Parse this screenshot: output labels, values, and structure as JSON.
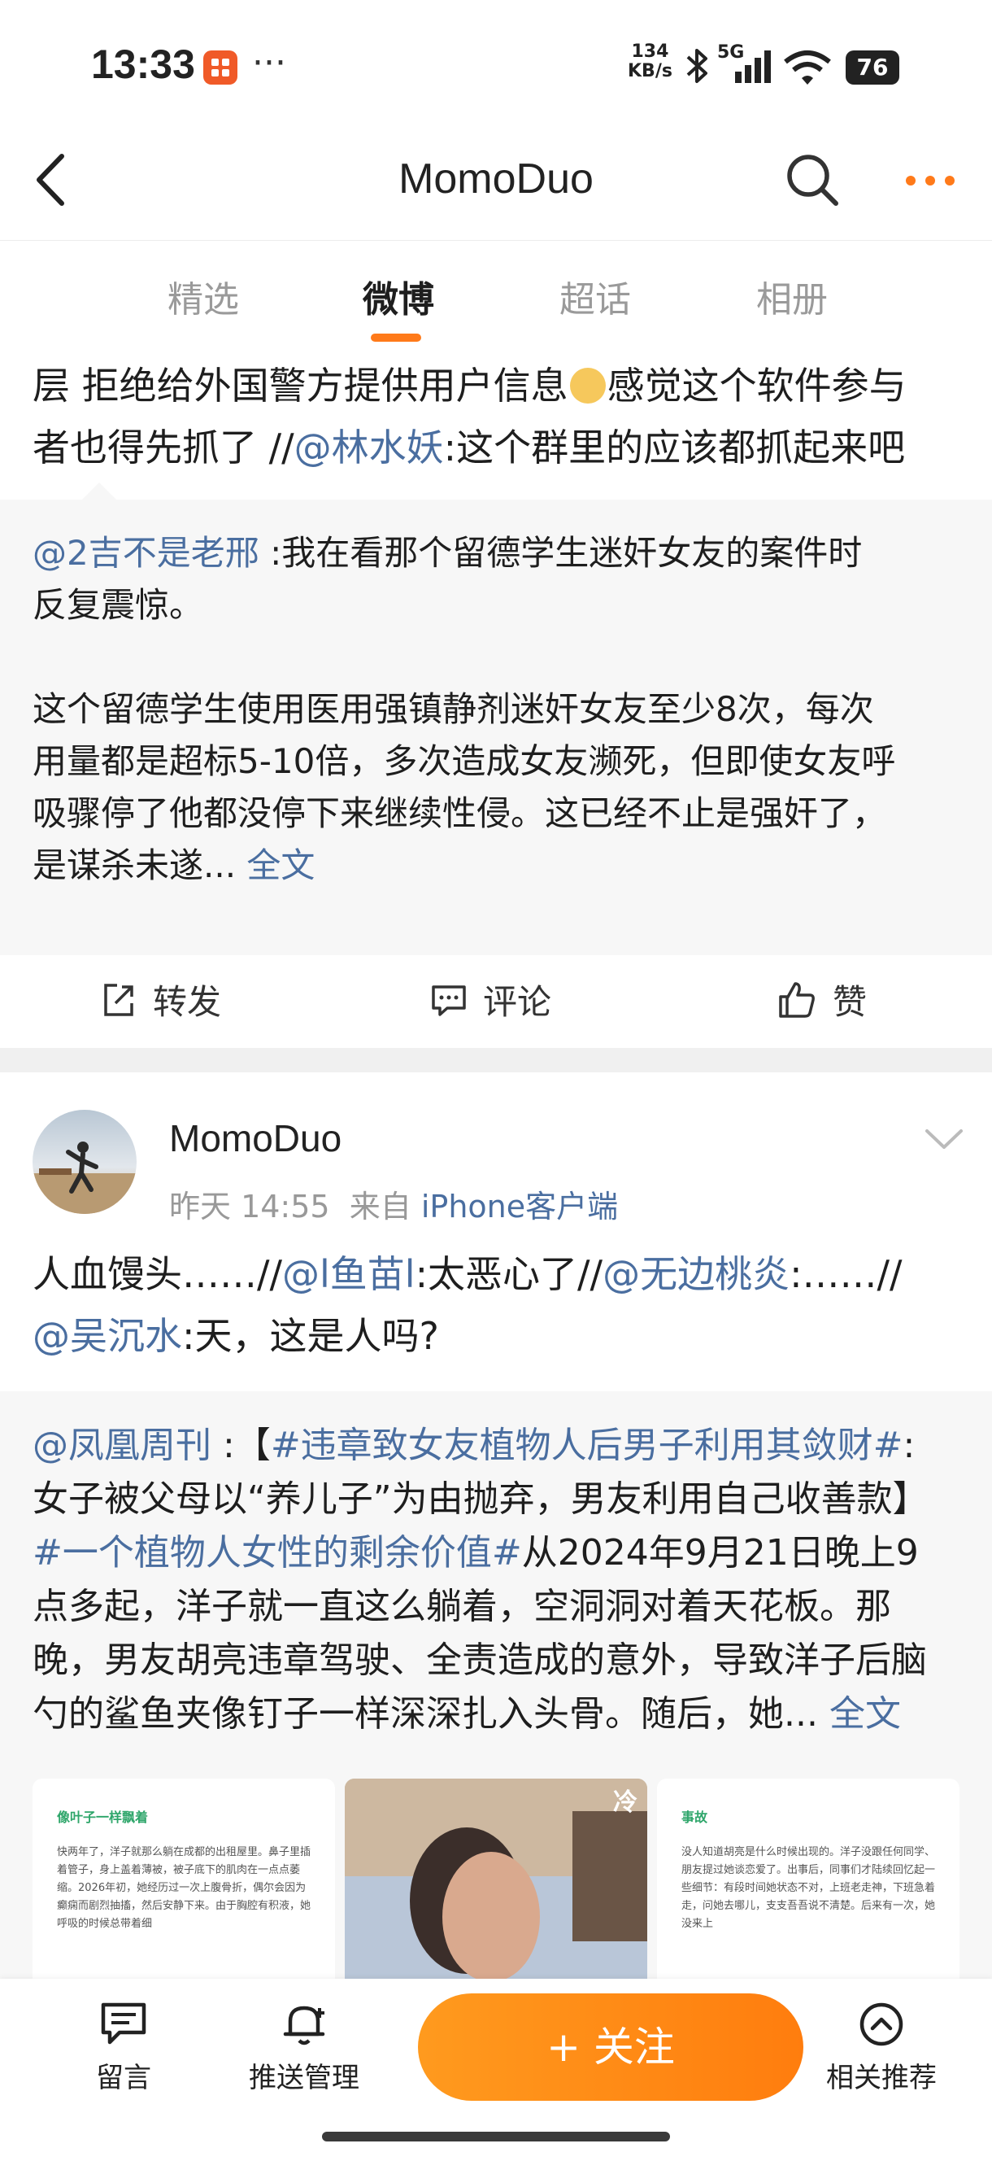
{
  "status_bar": {
    "time": "13:33",
    "dots": "···",
    "net_speed_value": "134",
    "net_speed_unit": "KB/s",
    "signal_label": "5G",
    "battery": "76"
  },
  "header": {
    "title": "MomoDuo",
    "back_icon": "chevron-left-icon",
    "search_icon": "search-icon",
    "more_icon": "more-dots-icon",
    "accent": "#ff7a1a"
  },
  "tabs": [
    {
      "label": "精选",
      "active": false
    },
    {
      "label": "微博",
      "active": true
    },
    {
      "label": "超话",
      "active": false
    },
    {
      "label": "相册",
      "active": false
    }
  ],
  "post1": {
    "repost_text_prefix": "层 拒绝给外国警方提供用户信息",
    "repost_text_mid": "感觉这个软件参与",
    "repost_line2_prefix": "者也得先抓了 //",
    "repost_mention": "@林水妖",
    "repost_line2_suffix": ":这个群里的应该都抓起来吧",
    "quote": {
      "author": "@2吉不是老邢",
      "line1_suffix": " :我在看那个留德学生迷奸女友的案件时",
      "line2": "反复震惊。",
      "line3": "这个留德学生使用医用强镇静剂迷奸女友至少8次，每次",
      "line4": "用量都是超标5-10倍，多次造成女友濒死，但即使女友呼",
      "line5": "吸骤停了他都没停下来继续性侵。这已经不止是强奸了，",
      "line6": "是谋杀未遂...",
      "full_text": "全文"
    },
    "actions": {
      "repost": "转发",
      "comment": "评论",
      "like": "赞"
    }
  },
  "post2": {
    "author": "MomoDuo",
    "time": "昨天 14:55",
    "from_label": "来自",
    "source": "iPhone客户端",
    "text_part1": "人血馒头……//",
    "mention1": "@l鱼苗l",
    "text_part2": ":太恶心了//",
    "mention2": "@无边桃炎",
    "text_part3": ":……//",
    "mention3": "@吴沉水",
    "text_part4": ":天，这是人吗?",
    "quote": {
      "author": "@凤凰周刊",
      "bracket_open": " :【",
      "hashtag1": "#违章致女友植物人后男子利用其敛财#",
      "colon": ":",
      "line2": "女子被父母以“养儿子”为由抛弃，男友利用自己收善款】",
      "hashtag2": "#一个植物人女性的剩余价值#",
      "line3_suffix": "从2024年9月21日晚上9",
      "line4": "点多起，洋子就一直这么躺着，空洞洞对着天花板。那",
      "line5": "晚，男友胡亮违章驾驶、全责造成的意外，导致洋子后脑",
      "line6": "勺的鲨鱼夹像钉子一样深深扎入头骨。随后，她...",
      "full_text": "全文"
    },
    "images": [
      {
        "title": "像叶子一样飘着",
        "text": "快两年了，洋子就那么躺在成都的出租屋里。鼻子里插着管子，身上盖着薄被，被子底下的肌肉在一点点萎缩。2026年初，她经历过一次上腹骨折，偶尔会因为癫痫而剧烈抽搐，然后安静下来。由于胸腔有积液，她呼吸的时候总带着细"
      },
      {
        "overlay": "冷"
      },
      {
        "title": "事故",
        "text": "没人知道胡亮是什么时候出现的。洋子没跟任何同学、朋友提过她谈恋爱了。出事后，同事们才陆续回忆起一些细节：有段时间她状态不对，上班老走神，下班急着走，问她去哪儿，支支吾吾说不清楚。后来有一次，她没来上"
      }
    ]
  },
  "bottom_bar": {
    "message": "留言",
    "push": "推送管理",
    "follow": "+ 关注",
    "recommend": "相关推荐"
  }
}
